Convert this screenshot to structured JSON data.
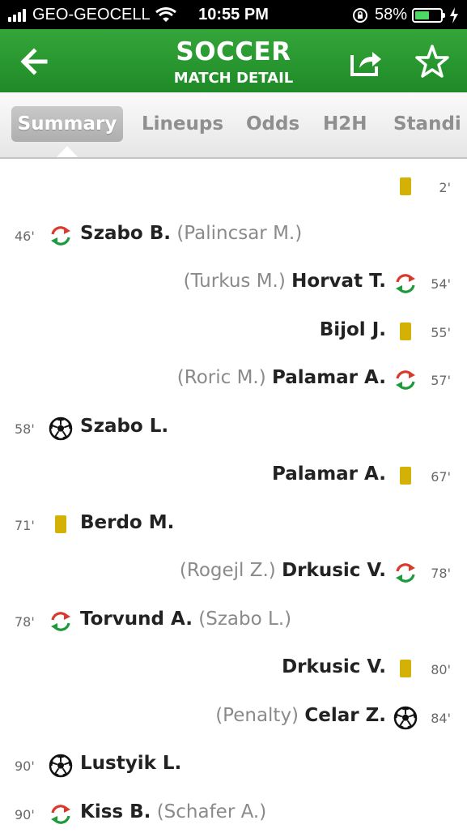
{
  "status_bar": {
    "carrier": "GEO-GEOCELL",
    "time": "10:55 PM",
    "battery": "58%",
    "battery_level": 0.58
  },
  "header": {
    "title": "SOCCER",
    "subtitle": "MATCH DETAIL"
  },
  "tabs": [
    "Summary",
    "Lineups",
    "Odds",
    "H2H",
    "Standi"
  ],
  "events": [
    {
      "side": "right",
      "minute": "2'",
      "type": "yellow-card",
      "player": "",
      "secondary": ""
    },
    {
      "side": "left",
      "minute": "46'",
      "type": "substitution",
      "player": "Szabo B.",
      "secondary": "(Palincsar M.)"
    },
    {
      "side": "right",
      "minute": "54'",
      "type": "substitution",
      "player": "Horvat T.",
      "secondary": "(Turkus M.)"
    },
    {
      "side": "right",
      "minute": "55'",
      "type": "yellow-card",
      "player": "Bijol J.",
      "secondary": ""
    },
    {
      "side": "right",
      "minute": "57'",
      "type": "substitution",
      "player": "Palamar A.",
      "secondary": "(Roric M.)"
    },
    {
      "side": "left",
      "minute": "58'",
      "type": "goal",
      "player": "Szabo L.",
      "secondary": ""
    },
    {
      "side": "right",
      "minute": "67'",
      "type": "yellow-card",
      "player": "Palamar A.",
      "secondary": ""
    },
    {
      "side": "left",
      "minute": "71'",
      "type": "yellow-card",
      "player": "Berdo M.",
      "secondary": ""
    },
    {
      "side": "right",
      "minute": "78'",
      "type": "substitution",
      "player": "Drkusic V.",
      "secondary": "(Rogejl Z.)"
    },
    {
      "side": "left",
      "minute": "78'",
      "type": "substitution",
      "player": "Torvund A.",
      "secondary": "(Szabo L.)"
    },
    {
      "side": "right",
      "minute": "80'",
      "type": "yellow-card",
      "player": "Drkusic V.",
      "secondary": ""
    },
    {
      "side": "right",
      "minute": "84'",
      "type": "goal",
      "player": "Celar Z.",
      "secondary": "(Penalty)"
    },
    {
      "side": "left",
      "minute": "90'",
      "type": "goal",
      "player": "Lustyik L.",
      "secondary": ""
    },
    {
      "side": "left",
      "minute": "90'",
      "type": "substitution",
      "player": "Kiss B.",
      "secondary": "(Schafer A.)"
    }
  ],
  "colors": {
    "header_green": "#2a9a31",
    "yellow_card": "#d4b106",
    "sub_green": "#1e9a3c",
    "sub_red": "#d93a2b"
  }
}
